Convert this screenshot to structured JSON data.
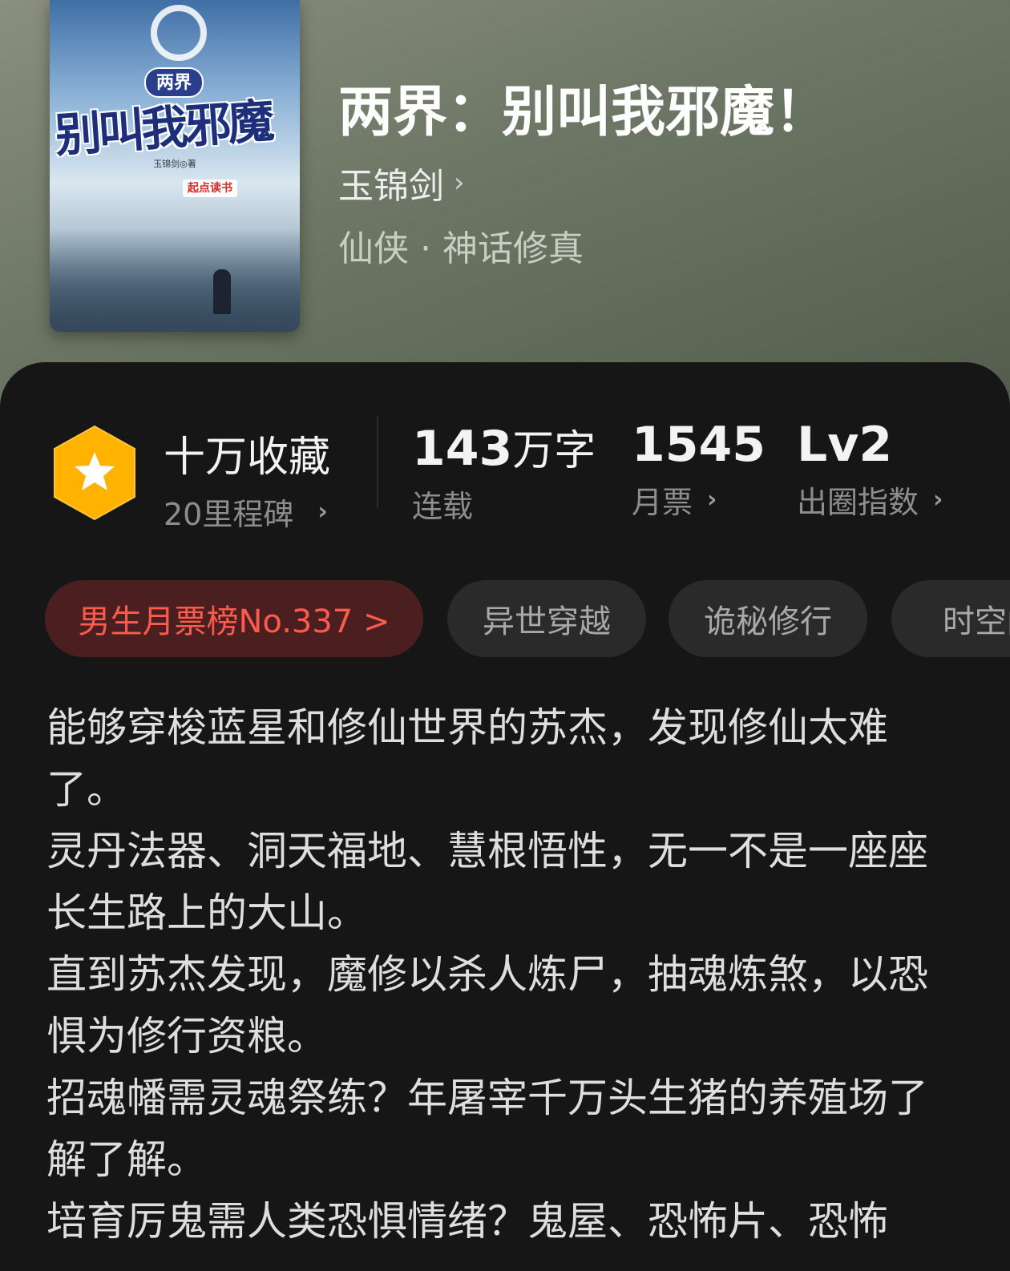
{
  "book": {
    "title": "两界：别叫我邪魔！",
    "author": "玉锦剑",
    "author_chevron": "›",
    "genre": "仙侠 · 神话修真",
    "cover": {
      "small_title": "两界",
      "big_title": "别叫我邪魔",
      "author_line": "玉锦剑◎著",
      "publisher": "起点读书"
    }
  },
  "stats": {
    "collect": {
      "label": "十万收藏",
      "sub": "20里程碑",
      "chevron": "›"
    },
    "words": {
      "num": "143",
      "unit": "万字",
      "sub": "连载"
    },
    "tickets": {
      "num": "1545",
      "sub": "月票",
      "chevron": "›"
    },
    "index": {
      "num": "Lv2",
      "sub": "出圈指数",
      "chevron": "›"
    }
  },
  "tags": [
    {
      "label": "男生月票榜No.337 >"
    },
    {
      "label": "异世穿越"
    },
    {
      "label": "诡秘修行"
    },
    {
      "label": "时空门"
    }
  ],
  "description": [
    "能够穿梭蓝星和修仙世界的苏杰，发现修仙太难了。",
    "灵丹法器、洞天福地、慧根悟性，无一不是一座座长生路上的大山。",
    "直到苏杰发现，魔修以杀人炼尸，抽魂炼煞，以恐惧为修行资粮。",
    "招魂幡需灵魂祭练？年屠宰千万头生猪的养殖场了解了解。",
    "培育厉鬼需人类恐惧情绪？鬼屋、恐怖片、恐怖"
  ],
  "colors": {
    "panel_bg": "#161616",
    "badge": "#ffb300",
    "rank_tag_text": "#ff5a4e",
    "rank_tag_bg": "#4b1f1f"
  }
}
